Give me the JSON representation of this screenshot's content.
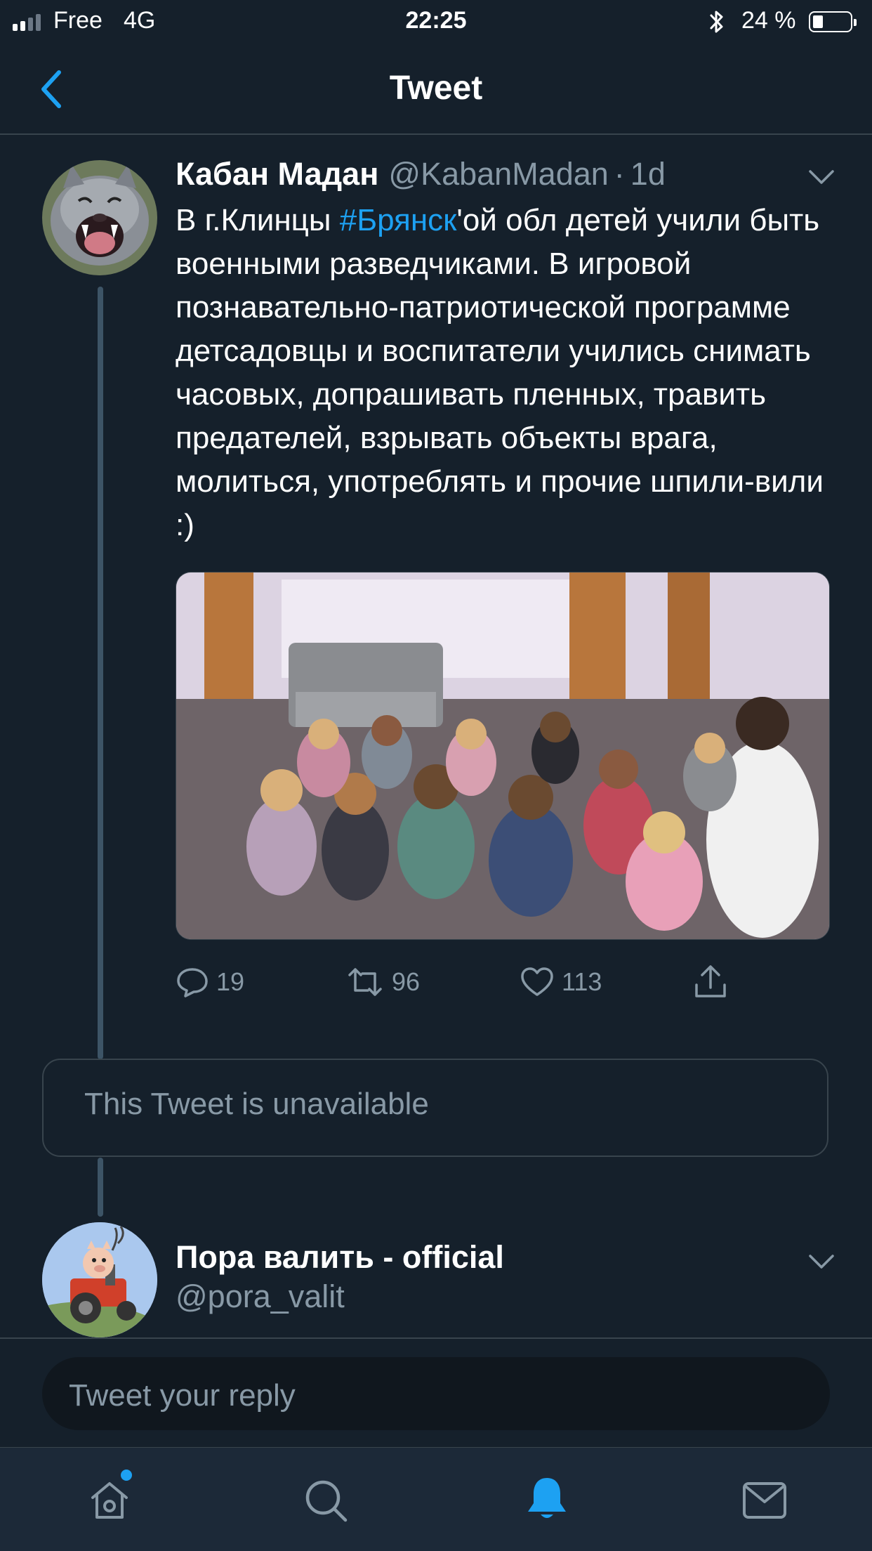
{
  "status_bar": {
    "carrier": "Free",
    "network": "4G",
    "time": "22:25",
    "battery_percent": "24 %",
    "battery_level": 0.24,
    "signal_bars": 2
  },
  "nav": {
    "title": "Tweet",
    "back_icon": "chevron-left-icon"
  },
  "tweet": {
    "author_name": "Кабан Мадан",
    "author_handle": "@KabanMadan",
    "separator": "·",
    "time_ago": "1d",
    "text_before": "В г.Клинцы ",
    "hashtag": "#Брянск",
    "text_after": "'ой обл детей учили быть военными разведчиками. В игровой познавательно-патриотической программе детсадовцы и воспитатели учились снимать часовых, допрашивать пленных, травить предателей, взрывать объекты врага, молиться, употреблять и прочие шпили-вили :)",
    "actions": {
      "replies": "19",
      "retweets": "96",
      "likes": "113"
    }
  },
  "unavailable_notice": "This Tweet is unavailable",
  "next_tweet": {
    "author_name": "Пора валить - official",
    "author_handle": "@pora_valit"
  },
  "reply": {
    "placeholder": "Tweet your reply"
  },
  "tab_bar": {
    "items": [
      "home-icon",
      "search-icon",
      "notifications-bell-icon",
      "messages-envelope-icon"
    ],
    "active": "notifications-bell-icon",
    "home_has_badge": true
  },
  "colors": {
    "background": "#15202b",
    "accent": "#1da1f2",
    "secondary_text": "#8899a6",
    "border": "#38444d"
  }
}
